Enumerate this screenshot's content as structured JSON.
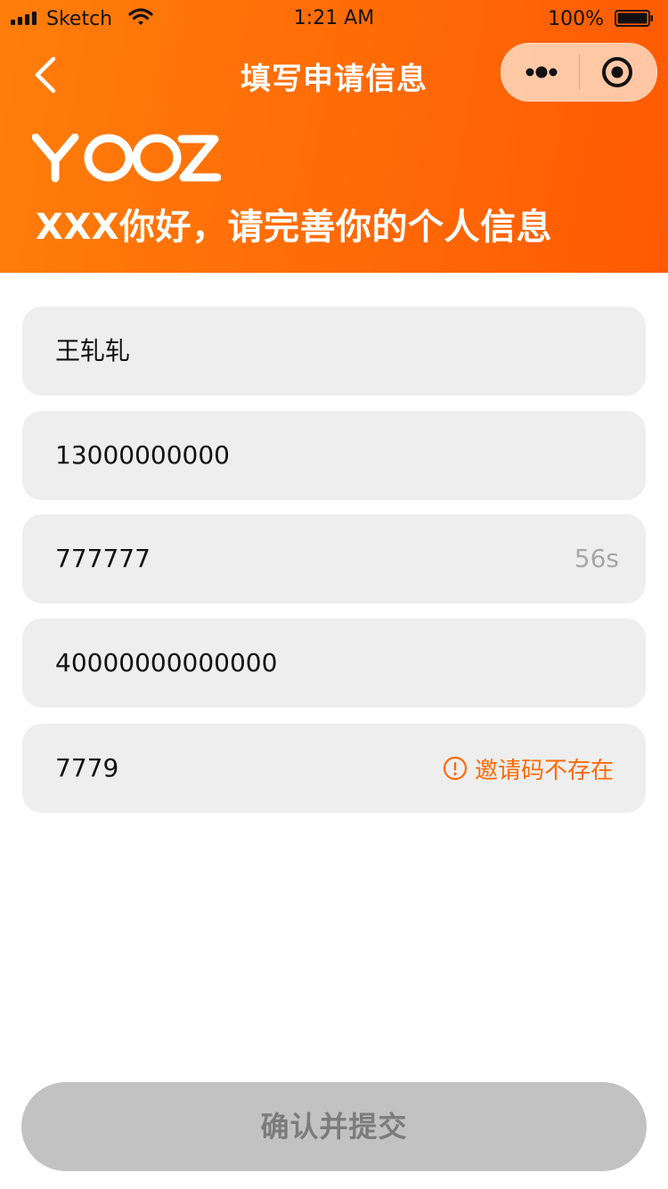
{
  "status_bar": {
    "carrier": "Sketch",
    "time": "1:21 AM",
    "battery": "100%",
    "icons": [
      "signal-icon",
      "wifi-icon",
      "battery-icon"
    ]
  },
  "nav": {
    "title": "填写申请信息",
    "icons": [
      "back-chevron-icon",
      "more-dots-icon",
      "close-target-icon"
    ]
  },
  "brand": {
    "logo_text": "YOOZ",
    "greeting": "XXX你好，请完善你的个人信息",
    "colors": {
      "header_start": "#ff7e0b",
      "header_end": "#ff5a03",
      "accent": "#ff6a06"
    }
  },
  "form": {
    "name": "王轧轧",
    "phone": "13000000000",
    "verify_code": "777777",
    "countdown": "56s",
    "id_number": "40000000000000",
    "invite_code": "7779",
    "invite_error": "邀请码不存在",
    "error_icon": "alert-circle-icon"
  },
  "submit": {
    "label": "确认并提交",
    "state": "disabled"
  }
}
